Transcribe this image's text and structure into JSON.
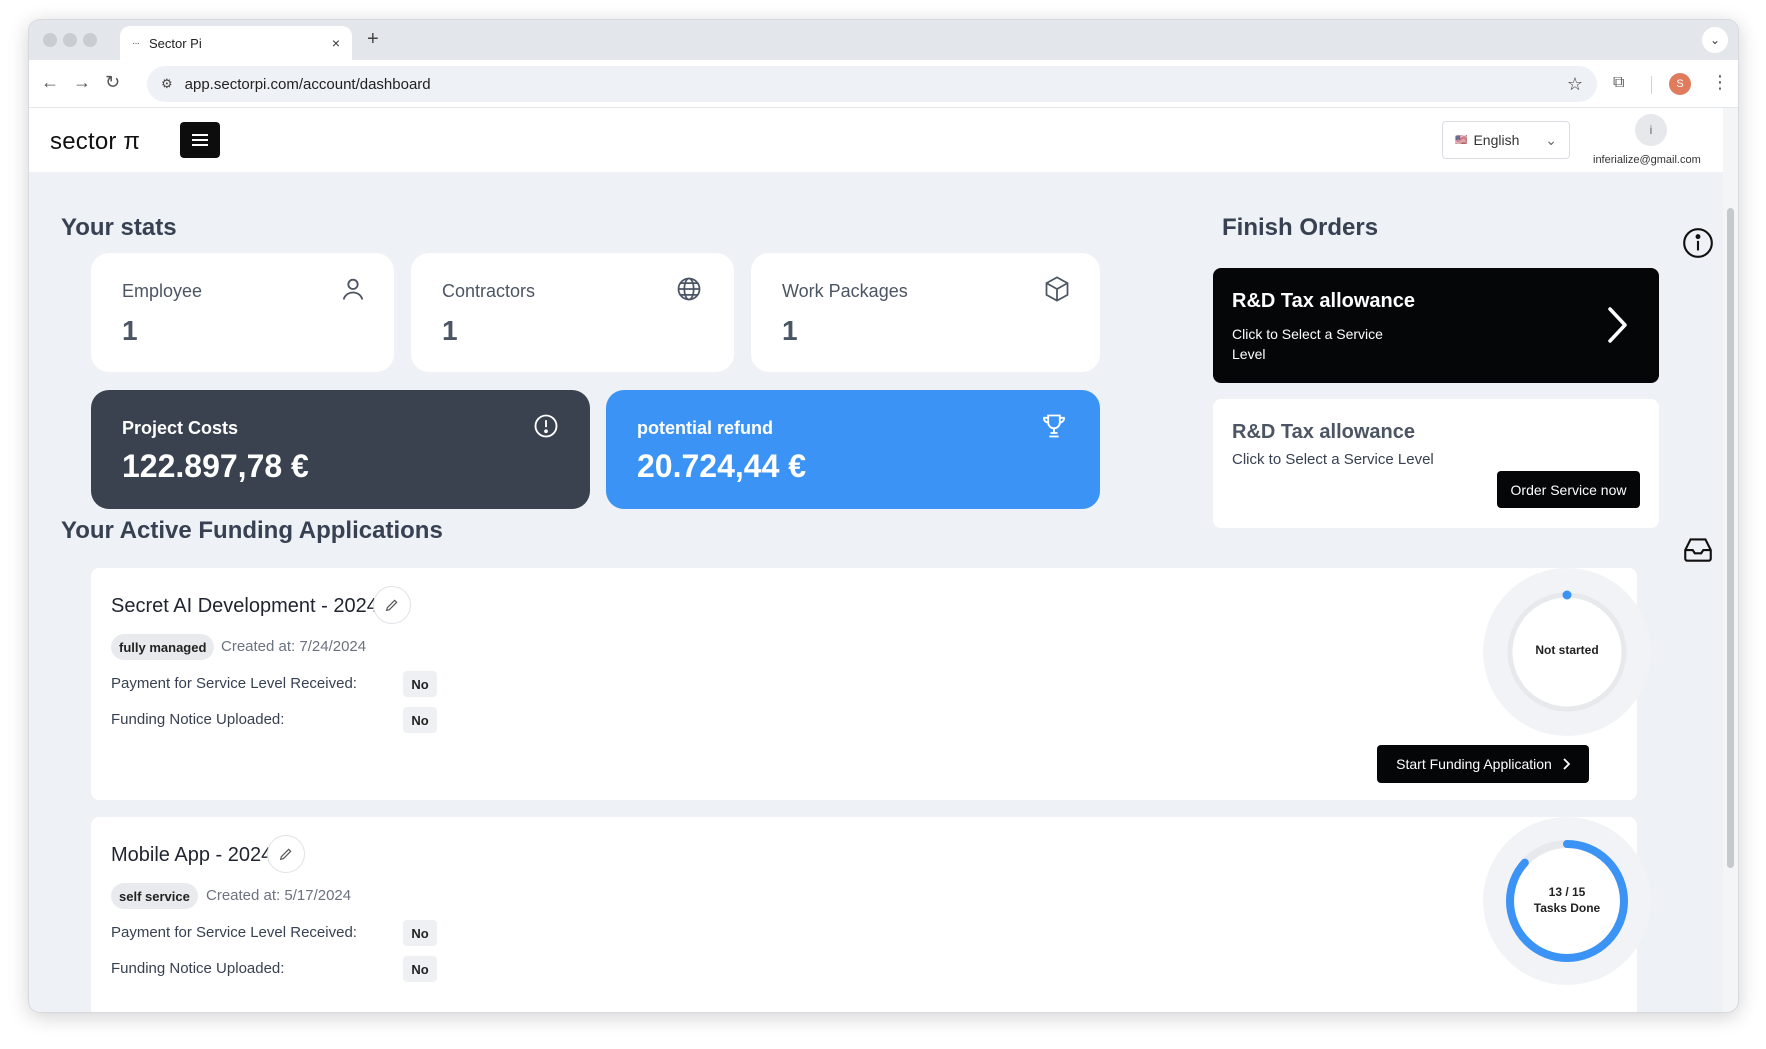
{
  "browser": {
    "tab_title": "Sector Pi",
    "tab_favicon": "···",
    "tab_close": "×",
    "new_tab": "+",
    "url": "app.sectorpi.com/account/dashboard",
    "profile_initial": "S"
  },
  "header": {
    "logo": "sector π",
    "language": "English",
    "language_flag": "🇺🇸",
    "avatar_initial": "i",
    "email": "inferialize@gmail.com"
  },
  "stats": {
    "title": "Your stats",
    "employee": {
      "label": "Employee",
      "value": "1",
      "icon": "user-icon"
    },
    "contractors": {
      "label": "Contractors",
      "value": "1",
      "icon": "globe-icon"
    },
    "work_packages": {
      "label": "Work Packages",
      "value": "1",
      "icon": "box-icon"
    },
    "project_costs": {
      "label": "Project Costs",
      "value": "122.897,78 €",
      "icon": "alert-circle-icon"
    },
    "potential_refund": {
      "label": "potential refund",
      "value": "20.724,44 €",
      "icon": "trophy-icon"
    }
  },
  "finish_orders": {
    "title": "Finish Orders",
    "items": [
      {
        "title": "R&D Tax allowance",
        "subtitle": "Click to Select a Service Level"
      },
      {
        "title": "R&D Tax allowance",
        "subtitle": "Click to Select a Service Level",
        "button": "Order Service now"
      }
    ]
  },
  "applications": {
    "title": "Your Active Funding Applications",
    "payment_label": "Payment for Service Level Received:",
    "notice_label": "Funding Notice Uploaded:",
    "items": [
      {
        "name": "Secret AI Development - 2024",
        "type": "fully managed",
        "created": "Created at: 7/24/2024",
        "payment": "No",
        "notice": "No",
        "status": "Not started",
        "progress": 0,
        "button": "Start Funding Application"
      },
      {
        "name": "Mobile App - 2024",
        "type": "self service",
        "created": "Created at: 5/17/2024",
        "payment": "No",
        "notice": "No",
        "tasks_done": 13,
        "tasks_total": 15,
        "tasks_text": "13 / 15",
        "tasks_label": "Tasks Done",
        "progress": 0.8667
      }
    ]
  },
  "colors": {
    "accent_blue": "#3b93f5",
    "dark_card": "#3a4250",
    "black_button": "#050608",
    "page_bg": "#eef1f5"
  }
}
